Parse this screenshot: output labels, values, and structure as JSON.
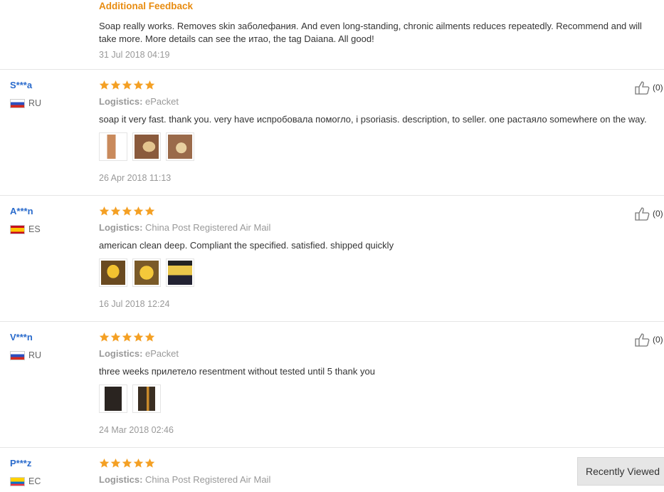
{
  "additional_feedback": {
    "title": "Additional Feedback",
    "text": "Soap really works. Removes skin заболефания. And even long-standing, chronic ailments reduces repeatedly. Recommend and will take more. More details can see the итао, the tag Daiana. All good!",
    "date": "31 Jul 2018 04:19"
  },
  "logistics_label": "Logistics:",
  "reviews": [
    {
      "user": "S***a",
      "country": "RU",
      "flag": "flag-ru",
      "rating": 5,
      "logistics": "ePacket",
      "text": "soap it very fast. thank you. very have испробовала помогло, i psoriasis. description, to seller. one растаяло somewhere on the way.",
      "date": "26 Apr 2018 11:13",
      "helpful": "(0)",
      "photos": 3
    },
    {
      "user": "A***n",
      "country": "ES",
      "flag": "flag-es",
      "rating": 5,
      "logistics": "China Post Registered Air Mail",
      "text": "american clean deep. Compliant the specified. satisfied. shipped quickly",
      "date": "16 Jul 2018 12:24",
      "helpful": "(0)",
      "photos": 3
    },
    {
      "user": "V***n",
      "country": "RU",
      "flag": "flag-ru",
      "rating": 5,
      "logistics": "ePacket",
      "text": "three weeks прилетело resentment without tested until 5 thank you",
      "date": "24 Mar 2018 02:46",
      "helpful": "(0)",
      "photos": 2
    },
    {
      "user": "P***z",
      "country": "EC",
      "flag": "flag-ec",
      "rating": 5,
      "logistics": "China Post Registered Air Mail"
    }
  ],
  "recently_viewed": "Recently Viewed",
  "colors": {
    "accent_orange": "#e88c10",
    "star": "#f4a024",
    "username_blue": "#2a6bcc"
  }
}
